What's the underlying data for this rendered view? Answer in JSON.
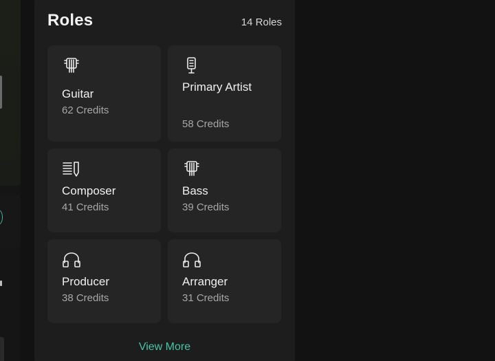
{
  "roles": {
    "title": "Roles",
    "count_label": "14 Roles",
    "tiles": [
      {
        "icon": "guitar-icon",
        "name": "Guitar",
        "credits": "62 Credits"
      },
      {
        "icon": "microphone-icon",
        "name": "Primary Artist",
        "credits": "58 Credits"
      },
      {
        "icon": "sheet-music-pen-icon",
        "name": "Composer",
        "credits": "41 Credits"
      },
      {
        "icon": "bass-icon",
        "name": "Bass",
        "credits": "39 Credits"
      },
      {
        "icon": "headphones-icon",
        "name": "Producer",
        "credits": "38 Credits"
      },
      {
        "icon": "headphones-icon",
        "name": "Arranger",
        "credits": "31 Credits"
      }
    ],
    "view_more_label": "View More"
  },
  "colors": {
    "accent": "#47c4a6",
    "card_background": "#1d1d1d",
    "tile_background": "#252525"
  }
}
